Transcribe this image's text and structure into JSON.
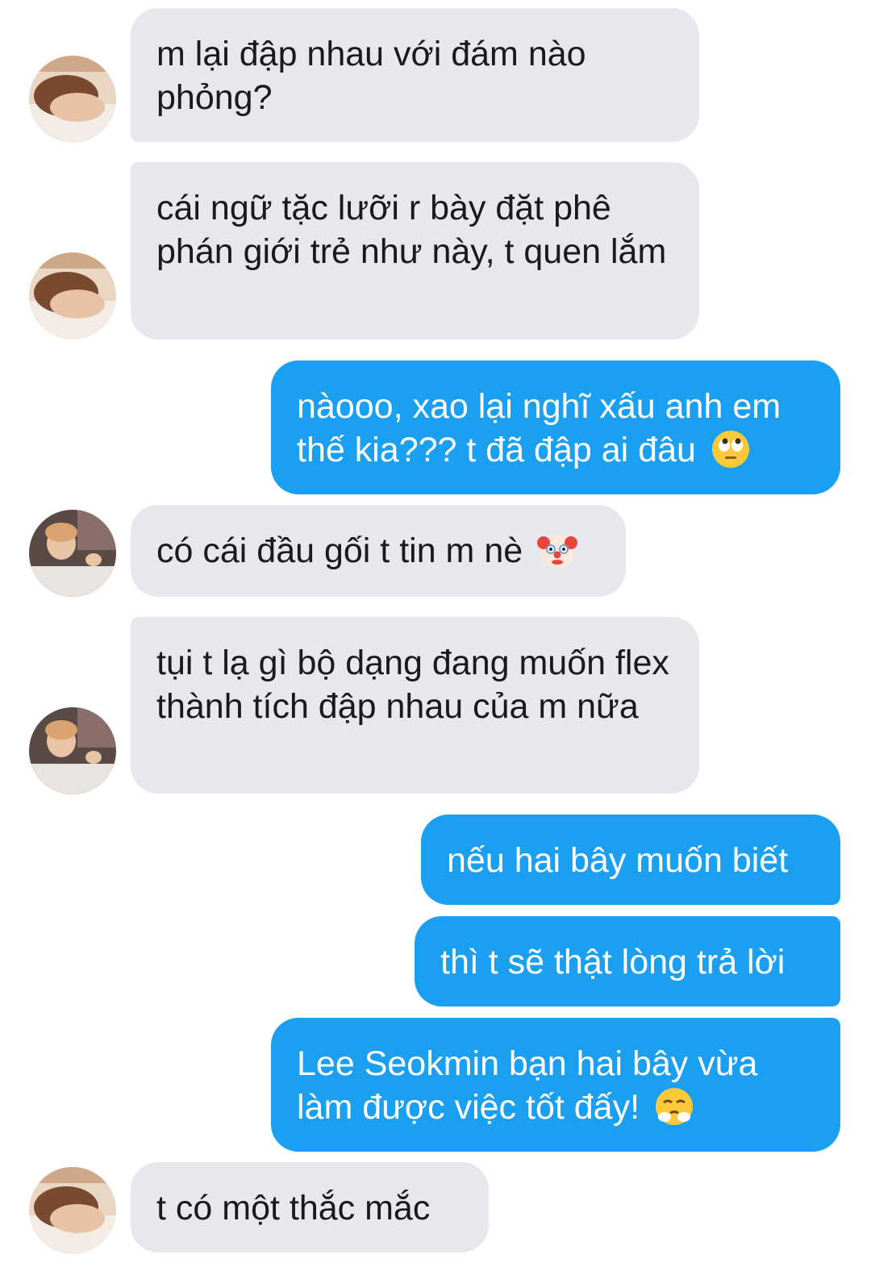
{
  "colors": {
    "incoming_bubble": "#e6e8ed",
    "outgoing_bubble": "#1a9ff1",
    "incoming_text": "#1a1a1a",
    "outgoing_text": "#ffffff"
  },
  "messages": [
    {
      "side": "in",
      "text": "m lại đập nhau với đám nào phỏng?",
      "avatar": "avatar-sleeping"
    },
    {
      "side": "in",
      "text": "cái ngữ tặc lưỡi r bày đặt phê phán giới trẻ như này, t quen lắm",
      "avatar": "avatar-sleeping"
    },
    {
      "side": "out",
      "text": "nàooo, xao lại nghĩ xấu anh em thế kia??? t đã đập ai đâu",
      "emoji": "face-with-rolling-eyes-icon"
    },
    {
      "side": "in",
      "text": "có cái đầu gối t tin m nè",
      "emoji": "clown-face-icon",
      "avatar": "avatar-waving"
    },
    {
      "side": "in",
      "text": "tụi t lạ gì bộ dạng đang muốn flex thành tích đập nhau của m nữa",
      "avatar": "avatar-waving"
    },
    {
      "side": "out",
      "text": "nếu hai bây muốn biết"
    },
    {
      "side": "out",
      "text": "thì t sẽ thật lòng trả lời"
    },
    {
      "side": "out",
      "text": "Lee Seokmin bạn hai bây vừa làm được việc tốt đấy!",
      "emoji": "face-with-steam-icon"
    },
    {
      "side": "in",
      "text": "t có một thắc mắc",
      "avatar": "avatar-sleeping"
    }
  ]
}
